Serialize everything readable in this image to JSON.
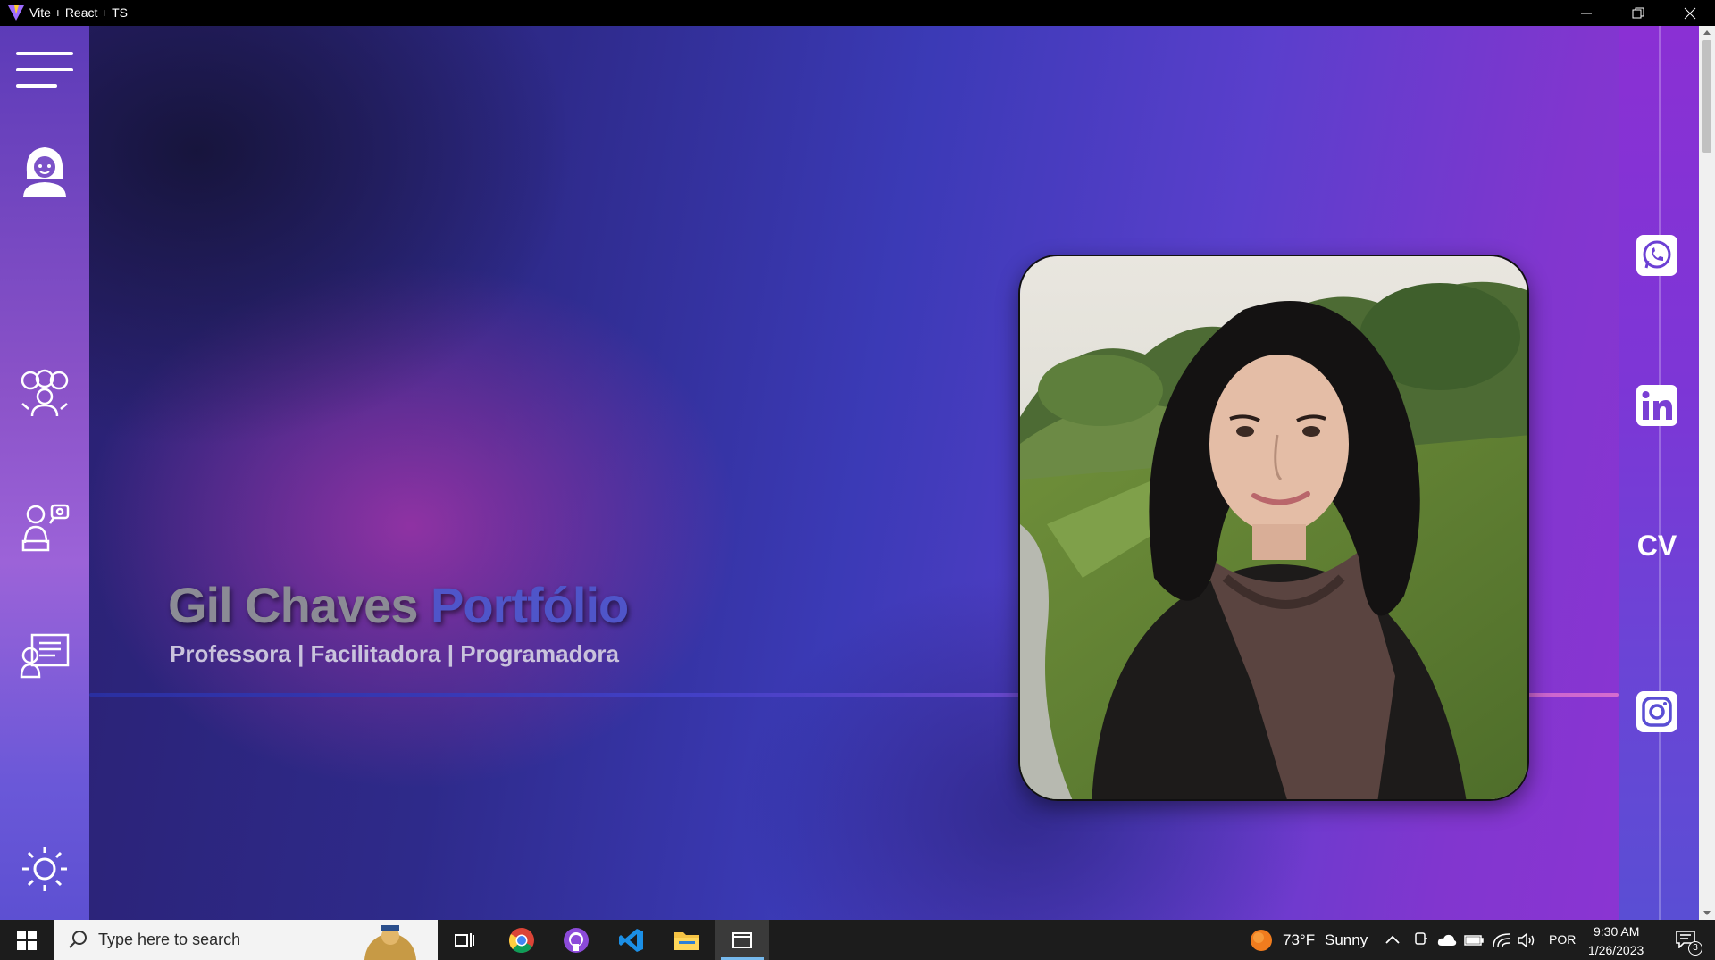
{
  "window": {
    "title": "Vite + React + TS"
  },
  "sidebar": {
    "items": [
      {
        "name": "menu",
        "icon": "hamburger-menu-icon"
      },
      {
        "name": "about",
        "icon": "person-avatar-icon"
      },
      {
        "name": "team",
        "icon": "group-people-icon"
      },
      {
        "name": "teaching",
        "icon": "teacher-at-desk-icon"
      },
      {
        "name": "projects",
        "icon": "presentation-board-icon"
      },
      {
        "name": "theme",
        "icon": "sun-icon"
      }
    ]
  },
  "hero": {
    "title_main": "Gil Chaves ",
    "title_accent": "Portfólio",
    "subtitle": "Professora | Facilitadora | Programadora"
  },
  "social": {
    "whatsapp_icon": "whatsapp-icon",
    "linkedin_icon": "linkedin-icon",
    "cv_label": "CV",
    "instagram_icon": "instagram-icon"
  },
  "taskbar": {
    "search_placeholder": "Type here to search",
    "weather_temp": "73°F",
    "weather_condition": "Sunny",
    "language": "POR",
    "time": "9:30 AM",
    "date": "1/26/2023",
    "notification_count": "3"
  },
  "colors": {
    "accent_title": "#4f55c9",
    "sidebar": "#8a52c8",
    "rail": "#7d36d6"
  }
}
